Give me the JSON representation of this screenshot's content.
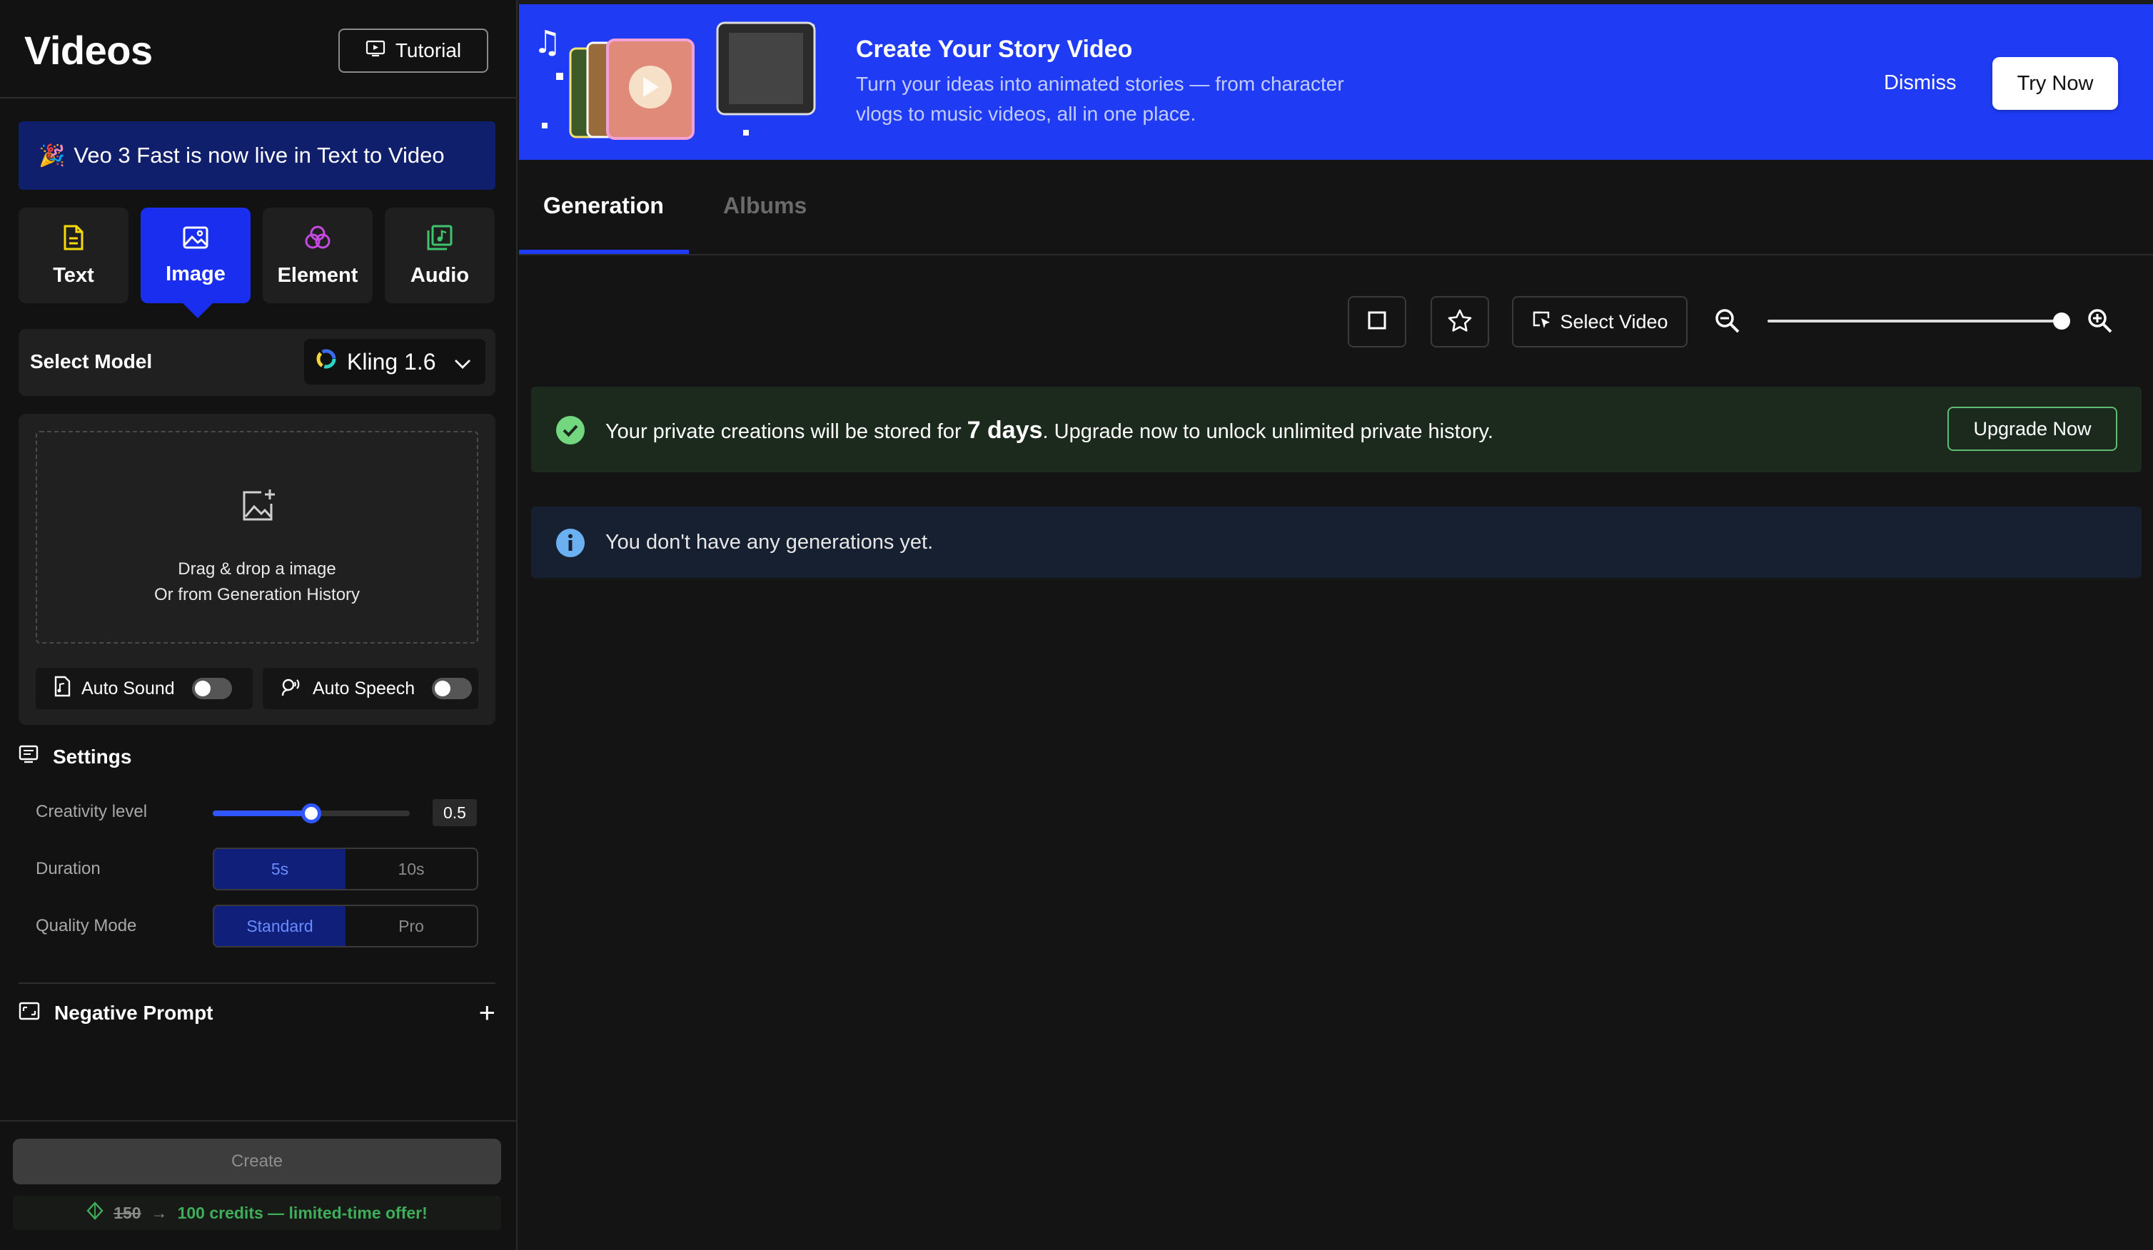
{
  "sidebar": {
    "title": "Videos",
    "tutorial_label": "Tutorial",
    "announcement": "Veo 3 Fast is now live in Text to Video",
    "modes": [
      {
        "label": "Text",
        "icon": "document-icon",
        "color": "#f5d90a"
      },
      {
        "label": "Image",
        "icon": "image-icon",
        "color": "#ffffff"
      },
      {
        "label": "Element",
        "icon": "element-icon",
        "color": "#c44ae0"
      },
      {
        "label": "Audio",
        "icon": "music-icon",
        "color": "#3ec46d"
      }
    ],
    "active_mode": "Image",
    "select_model_label": "Select Model",
    "model_value": "Kling 1.6",
    "dropzone": {
      "line1": "Drag & drop a image",
      "line2": "Or from Generation History"
    },
    "auto_sound_label": "Auto Sound",
    "auto_speech_label": "Auto Speech",
    "settings_title": "Settings",
    "creativity": {
      "label": "Creativity level",
      "value": "0.5",
      "fraction": 0.5
    },
    "duration": {
      "label": "Duration",
      "options": [
        "5s",
        "10s"
      ],
      "selected": "5s"
    },
    "quality": {
      "label": "Quality Mode",
      "options": [
        "Standard",
        "Pro"
      ],
      "selected": "Standard"
    },
    "negative_prompt_label": "Negative Prompt",
    "create_label": "Create",
    "credits": {
      "old": "150",
      "offer": "100 credits — limited-time offer!"
    }
  },
  "banner": {
    "title": "Create Your Story Video",
    "subtitle_line1": "Turn your ideas into animated stories — from character",
    "subtitle_line2": "vlogs to music videos, all in one place.",
    "dismiss_label": "Dismiss",
    "try_now_label": "Try Now",
    "bg_color": "#1f3bf3"
  },
  "tabs": [
    {
      "label": "Generation",
      "active": true
    },
    {
      "label": "Albums",
      "active": false
    }
  ],
  "toolbar": {
    "select_video_label": "Select Video",
    "zoom_fraction": 1.0
  },
  "notices": {
    "storage_pre": "Your private creations will be stored for ",
    "storage_days": "7 days",
    "storage_post": ". Upgrade now to unlock unlimited private history.",
    "upgrade_label": "Upgrade Now",
    "empty_message": "You don't have any generations yet."
  },
  "colors": {
    "accent": "#1a2eef",
    "success": "#3fae5a",
    "info": "#6bb0f0"
  }
}
